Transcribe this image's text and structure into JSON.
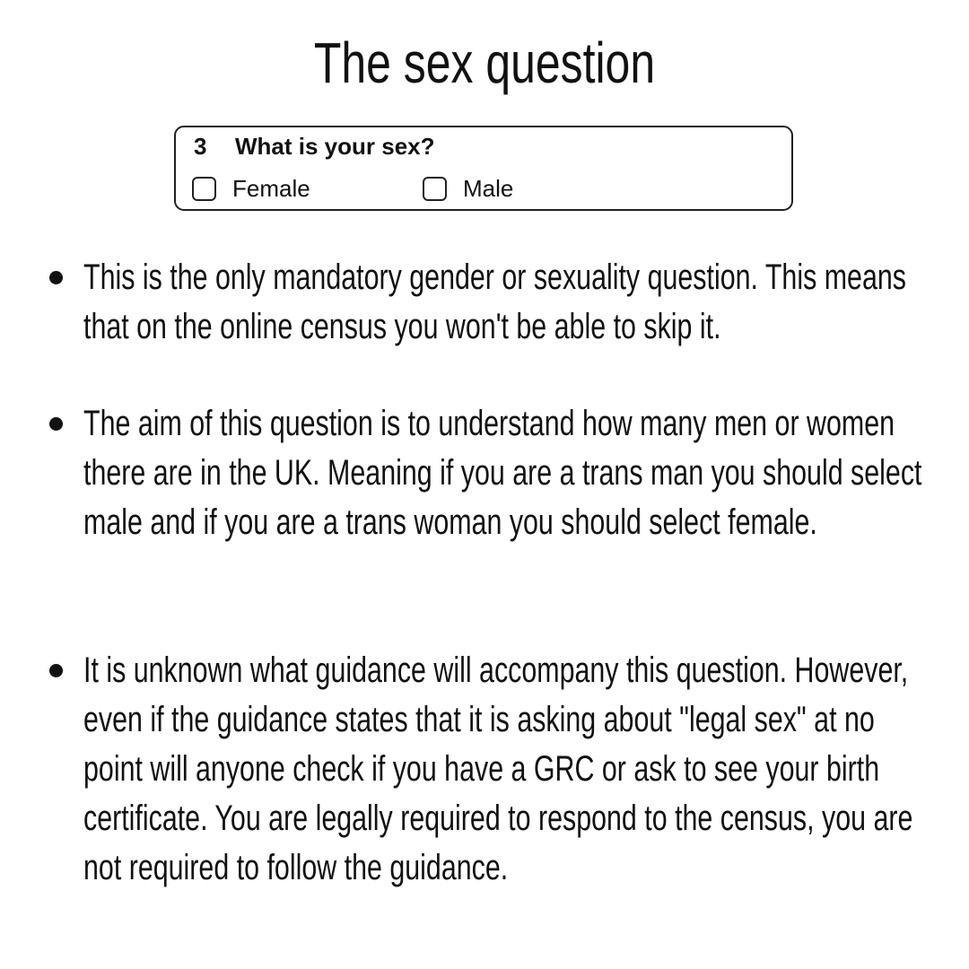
{
  "title": "The sex question",
  "form": {
    "number": "3",
    "question": "What is your sex?",
    "options": [
      "Female",
      "Male"
    ]
  },
  "bullets": [
    "This is the only mandatory gender or sexuality question. This means that on the online census you won't be able to skip it.",
    "The aim of this question is to understand how many men or women there are in the UK. Meaning if you are a trans man you should select male and if you are a trans woman you should select female.",
    "It is unknown what guidance will accompany this question. However, even if the guidance states that it is asking about \"legal sex\" at no point will anyone check if you have a GRC or ask to see your birth certificate.  You are legally required to respond to the census, you are not required to follow the guidance."
  ]
}
